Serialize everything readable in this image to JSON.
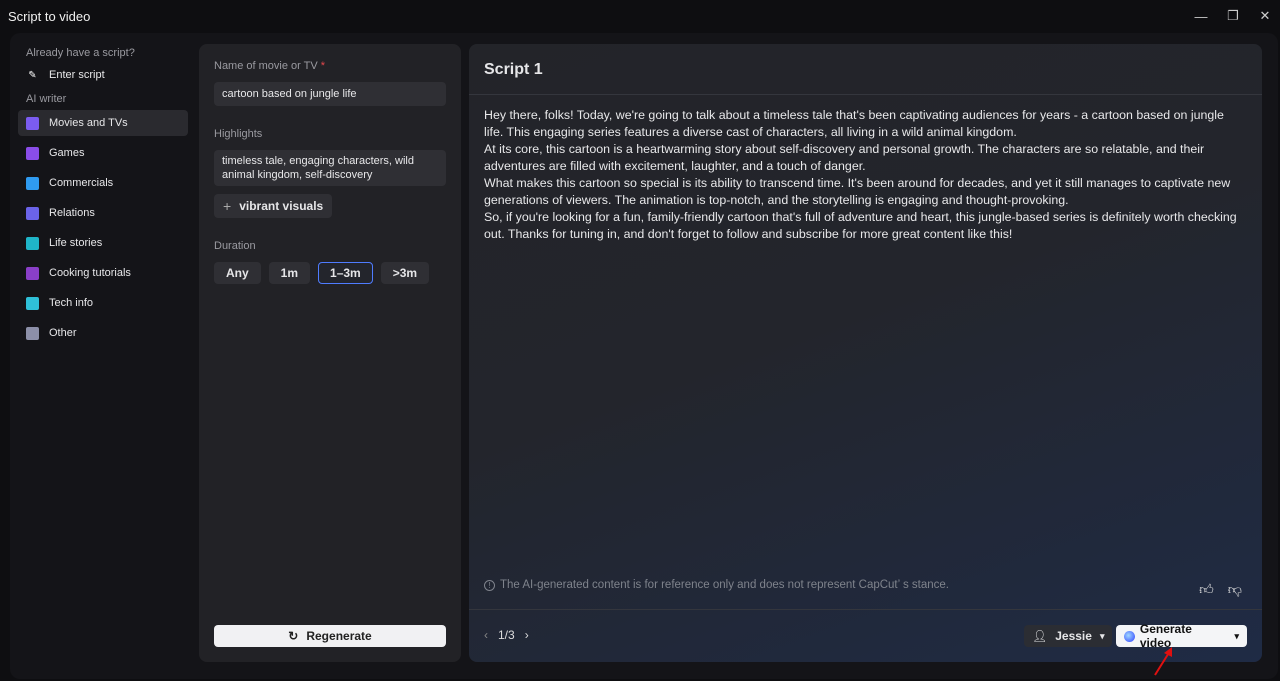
{
  "window": {
    "title": "Script to video",
    "controls": [
      "minimize",
      "maximize",
      "close"
    ]
  },
  "sidebar": {
    "section_script": "Already have a script?",
    "enter_script": "Enter script",
    "section_ai": "AI writer",
    "items": [
      {
        "label": "Movies and TVs",
        "icon": "clapper-icon",
        "color": "#7b5cf0",
        "active": true
      },
      {
        "label": "Games",
        "icon": "gamepad-icon",
        "color": "#8a4de8"
      },
      {
        "label": "Commercials",
        "icon": "billboard-icon",
        "color": "#2f9bf0"
      },
      {
        "label": "Relations",
        "icon": "people-icon",
        "color": "#6b63e8"
      },
      {
        "label": "Life stories",
        "icon": "person-wave-icon",
        "color": "#1fb5c8"
      },
      {
        "label": "Cooking tutorials",
        "icon": "wine-glass-icon",
        "color": "#8a3fc8"
      },
      {
        "label": "Tech info",
        "icon": "rocket-icon",
        "color": "#2fc0d8"
      },
      {
        "label": "Other",
        "icon": "note-icon",
        "color": "#8c8fa8"
      }
    ]
  },
  "form": {
    "name_label": "Name of movie or TV",
    "required_mark": "*",
    "name_value": "cartoon based on jungle life",
    "highlights_label": "Highlights",
    "highlights_value": "timeless tale, engaging characters, wild animal kingdom, self-discovery",
    "suggestion": "vibrant visuals",
    "duration_label": "Duration",
    "durations": [
      "Any",
      "1m",
      "1–3m",
      ">3m"
    ],
    "selected_duration": "1–3m",
    "regenerate": "Regenerate"
  },
  "script": {
    "title": "Script 1",
    "paragraphs": [
      "Hey there, folks! Today, we're going to talk about a timeless tale that's been captivating audiences for years - a cartoon based on jungle life. This engaging series features a diverse cast of characters, all living in a wild animal kingdom.",
      "At its core, this cartoon is a heartwarming story about self-discovery and personal growth. The characters are so relatable, and their adventures are filled with excitement, laughter, and a touch of danger.",
      "What makes this cartoon so special is its ability to transcend time. It's been around for decades, and yet it still manages to captivate new generations of viewers. The animation is top-notch, and the storytelling is engaging and thought-provoking.",
      "So, if you're looking for a fun, family-friendly cartoon that's full of adventure and heart, this jungle-based series is definitely worth checking out. Thanks for tuning in, and don't forget to follow and subscribe for more great content like this!"
    ],
    "disclaimer": "The AI-generated content is for reference only and does not represent CapCut’ s stance.",
    "page": "1/3",
    "voice": "Jessie",
    "generate": "Generate video"
  }
}
